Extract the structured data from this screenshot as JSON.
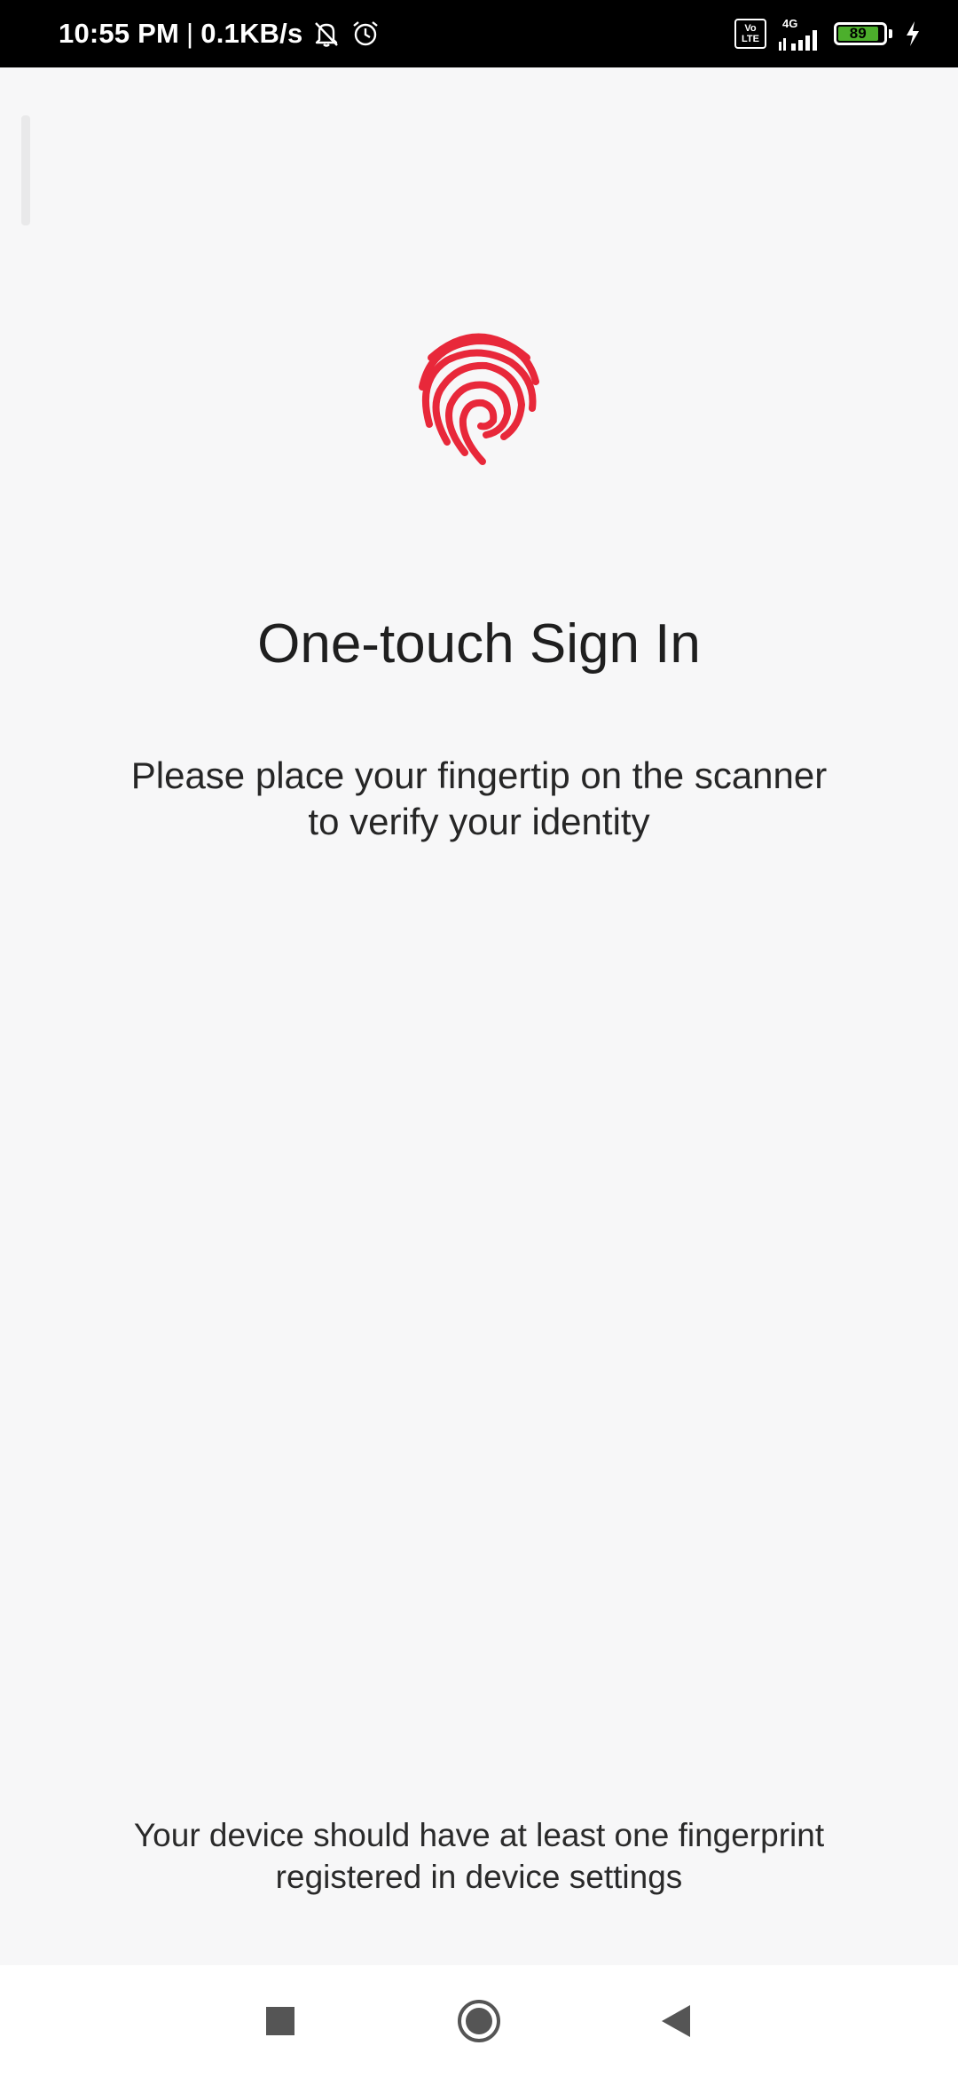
{
  "status_bar": {
    "time": "10:55 PM",
    "separator": "|",
    "net_speed": "0.1KB/s",
    "volte_top": "Vo",
    "volte_bottom": "LTE",
    "network": "4G",
    "battery": "89"
  },
  "main": {
    "icon": "fingerprint-icon",
    "accent_color": "#e8283a",
    "title": "One-touch Sign In",
    "subtitle_line1": "Please place your fingertip on the scanner",
    "subtitle_line2": "to verify your identity",
    "footnote_line1": "Your device should have at least one fingerprint",
    "footnote_line2": "registered in device settings"
  },
  "nav": {
    "recents_icon": "square-icon",
    "home_icon": "circle-icon",
    "back_icon": "triangle-back-icon"
  }
}
